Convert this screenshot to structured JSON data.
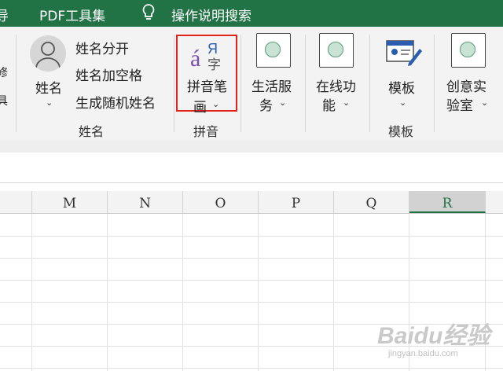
{
  "menubar": {
    "partial_label": "导",
    "pdf_tools": "PDF工具集",
    "tell_me": "操作说明搜索"
  },
  "ribbon": {
    "left_partial": [
      "修",
      "具"
    ],
    "name_group": {
      "name_button": "姓名",
      "items": [
        "姓名分开",
        "姓名加空格",
        "生成随机姓名"
      ],
      "group_label": "姓名"
    },
    "pinyin_group": {
      "button_line1": "拼音笔",
      "button_line2": "画",
      "group_label": "拼音"
    },
    "life_service": {
      "line1": "生活服",
      "line2": "务"
    },
    "online": {
      "line1": "在线功",
      "line2": "能"
    },
    "template_group": {
      "button": "模板",
      "group_label": "模板"
    },
    "creative": {
      "line1": "创意实",
      "line2": "验室"
    }
  },
  "columns": [
    {
      "letter": "M",
      "selected": false
    },
    {
      "letter": "N",
      "selected": false
    },
    {
      "letter": "O",
      "selected": false
    },
    {
      "letter": "P",
      "selected": false
    },
    {
      "letter": "Q",
      "selected": false
    },
    {
      "letter": "R",
      "selected": true
    }
  ],
  "chevron": "⌄",
  "colors": {
    "accent": "#217346",
    "highlight": "#e0241a",
    "pinyin_icon": "#7a4db0"
  },
  "icons": [
    "bulb-icon",
    "person-icon",
    "pinyin-icon",
    "template-icon"
  ],
  "watermark": {
    "brand": "Baidu经验",
    "url": "jingyan.baidu.com"
  }
}
